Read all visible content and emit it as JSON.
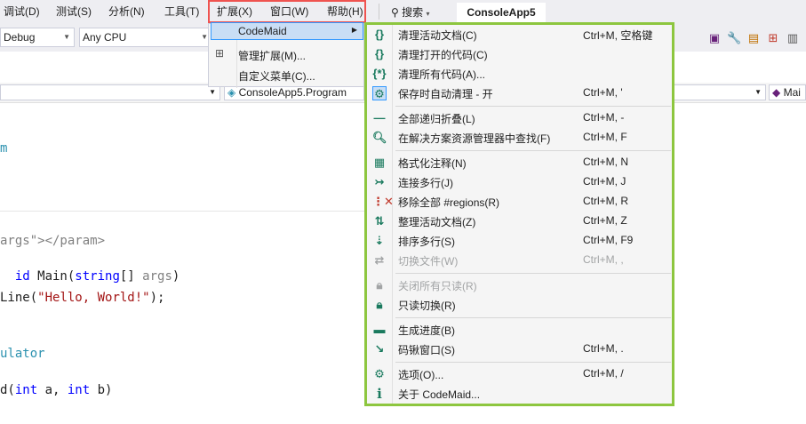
{
  "menubar": {
    "items": [
      "调试(D)",
      "测试(S)",
      "分析(N)",
      "工具(T)",
      "扩展(X)",
      "窗口(W)",
      "帮助(H)"
    ],
    "search_label": "搜索",
    "solution_title": "ConsoleApp5"
  },
  "toolbar": {
    "config": "Debug",
    "platform": "Any CPU"
  },
  "navbar": {
    "class_combo": "ConsoleApp5.Program",
    "member_combo": "Mai"
  },
  "code_lines": [
    "m",
    "args\"></param>",
    "id Main(string[] args)",
    "Line(\"Hello, World!\");",
    "ulator",
    "d(int a, int b)"
  ],
  "ext_menu": {
    "items": [
      {
        "label": "CodeMaid",
        "icon": "none",
        "has_submenu": true
      },
      {
        "label": "管理扩展(M)...",
        "icon": "manage-extensions-icon"
      },
      {
        "label": "自定义菜单(C)...",
        "icon": "none"
      }
    ]
  },
  "codemaid_menu": {
    "items": [
      {
        "label": "清理活动文档(C)",
        "shortcut": "Ctrl+M, 空格键",
        "icon": "braces-icon",
        "enabled": true
      },
      {
        "label": "清理打开的代码(C)",
        "shortcut": "",
        "icon": "braces-multi-icon",
        "enabled": true
      },
      {
        "label": "清理所有代码(A)...",
        "shortcut": "",
        "icon": "braces-all-icon",
        "enabled": true
      },
      {
        "label": "保存时自动清理 - 开",
        "shortcut": "Ctrl+M, '",
        "icon": "gear-toggle-icon",
        "enabled": true
      },
      {
        "label": "全部递归折叠(L)",
        "shortcut": "Ctrl+M, -",
        "icon": "minus-icon",
        "enabled": true
      },
      {
        "label": "在解决方案资源管理器中查找(F)",
        "shortcut": "Ctrl+M, F",
        "icon": "search-icon",
        "enabled": true
      },
      {
        "label": "格式化注释(N)",
        "shortcut": "Ctrl+M, N",
        "icon": "format-comments-icon",
        "enabled": true
      },
      {
        "label": "连接多行(J)",
        "shortcut": "Ctrl+M, J",
        "icon": "join-lines-icon",
        "enabled": true
      },
      {
        "label": "移除全部 #regions(R)",
        "shortcut": "Ctrl+M, R",
        "icon": "remove-regions-icon",
        "enabled": true
      },
      {
        "label": "整理活动文档(Z)",
        "shortcut": "Ctrl+M, Z",
        "icon": "reorganize-icon",
        "enabled": true
      },
      {
        "label": "排序多行(S)",
        "shortcut": "Ctrl+M, F9",
        "icon": "sort-icon",
        "enabled": true
      },
      {
        "label": "切换文件(W)",
        "shortcut": "Ctrl+M, ,",
        "icon": "switch-file-icon",
        "enabled": false
      },
      {
        "label": "关闭所有只读(R)",
        "shortcut": "",
        "icon": "lock-icon",
        "enabled": false
      },
      {
        "label": "只读切换(R)",
        "shortcut": "",
        "icon": "lock-icon",
        "enabled": true
      },
      {
        "label": "生成进度(B)",
        "shortcut": "",
        "icon": "progress-icon",
        "enabled": true
      },
      {
        "label": "码锹窗口(S)",
        "shortcut": "Ctrl+M, .",
        "icon": "spade-icon",
        "enabled": true
      },
      {
        "label": "选项(O)...",
        "shortcut": "Ctrl+M, /",
        "icon": "gear-icon",
        "enabled": true
      },
      {
        "label": "关于 CodeMaid...",
        "shortcut": "",
        "icon": "info-icon",
        "enabled": true
      }
    ]
  },
  "colors": {
    "codemaid_icon": "#1a7a5e",
    "highlight_border": "#8dc63f",
    "menu_box_border": "#ef5350"
  }
}
